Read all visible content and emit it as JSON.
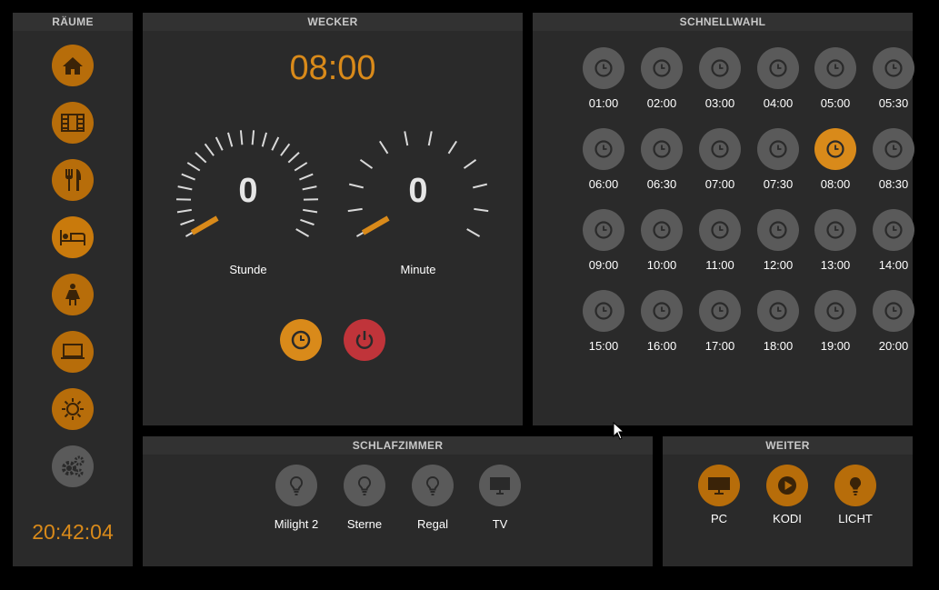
{
  "rooms": {
    "title": "RÄUME",
    "buttons": [
      {
        "icon": "home-icon",
        "state": "orange"
      },
      {
        "icon": "film-icon",
        "state": "orange"
      },
      {
        "icon": "fork-knife-icon",
        "state": "orange"
      },
      {
        "icon": "bed-icon",
        "state": "active"
      },
      {
        "icon": "person-icon",
        "state": "orange"
      },
      {
        "icon": "laptop-icon",
        "state": "orange"
      },
      {
        "icon": "sun-icon",
        "state": "orange"
      },
      {
        "icon": "gears-icon",
        "state": "gray"
      }
    ],
    "clock": "20:42:04"
  },
  "alarm": {
    "title": "WECKER",
    "time": "08:00",
    "hour": {
      "value": "0",
      "label": "Stunde"
    },
    "minute": {
      "value": "0",
      "label": "Minute"
    }
  },
  "quick": {
    "title": "SCHNELLWAHL",
    "times": [
      "01:00",
      "02:00",
      "03:00",
      "04:00",
      "05:00",
      "05:30",
      "06:00",
      "06:30",
      "07:00",
      "07:30",
      "08:00",
      "08:30",
      "09:00",
      "10:00",
      "11:00",
      "12:00",
      "13:00",
      "14:00",
      "15:00",
      "16:00",
      "17:00",
      "18:00",
      "19:00",
      "20:00"
    ],
    "selected": "08:00"
  },
  "bedroom": {
    "title": "SCHLAFZIMMER",
    "devices": [
      {
        "label": "Milight 2",
        "icon": "bulb-icon"
      },
      {
        "label": "Sterne",
        "icon": "bulb-icon"
      },
      {
        "label": "Regal",
        "icon": "bulb-icon"
      },
      {
        "label": "TV",
        "icon": "monitor-icon"
      }
    ]
  },
  "more": {
    "title": "WEITER",
    "devices": [
      {
        "label": "PC",
        "icon": "monitor-icon"
      },
      {
        "label": "KODI",
        "icon": "play-icon"
      },
      {
        "label": "LICHT",
        "icon": "bulb-icon"
      }
    ]
  },
  "colors": {
    "accent": "#d98a1a",
    "panel": "#2a2a2a",
    "off": "#5a5a5a",
    "power": "#c0343a"
  }
}
